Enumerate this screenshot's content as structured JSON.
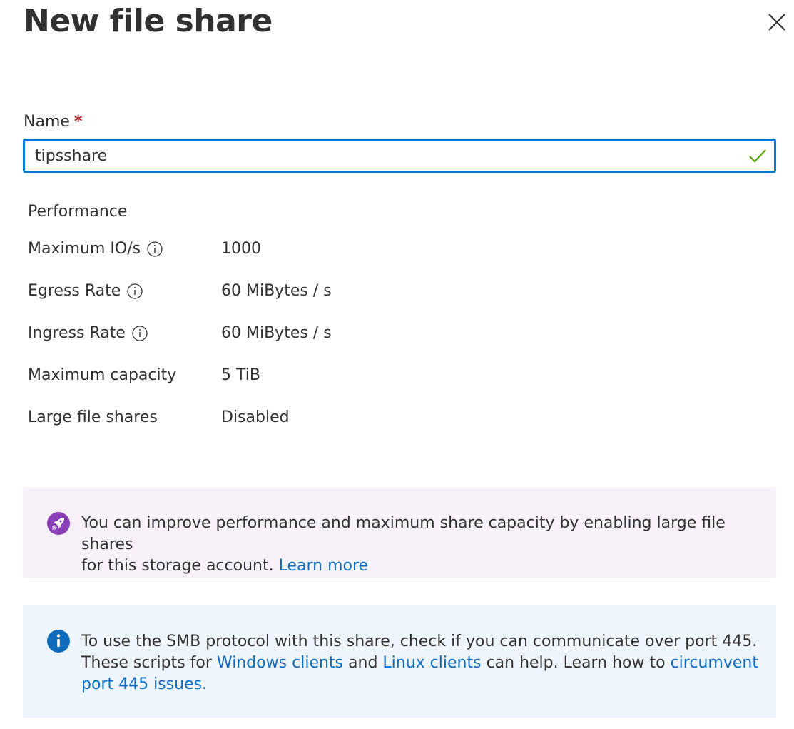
{
  "panel": {
    "title": "New file share",
    "close_icon": "close-icon"
  },
  "name_field": {
    "label": "Name",
    "required_marker": "*",
    "value": "tipsshare",
    "status_icon": "checkmark-icon",
    "status_color": "#57a300",
    "border_color": "#0078d4"
  },
  "performance": {
    "heading": "Performance",
    "rows": [
      {
        "label": "Maximum IO/s",
        "value": "1000",
        "info_icon": true
      },
      {
        "label": "Egress Rate",
        "value": "60 MiBytes / s",
        "info_icon": true
      },
      {
        "label": "Ingress Rate",
        "value": "60 MiBytes / s",
        "info_icon": true
      },
      {
        "label": "Maximum capacity",
        "value": "5 TiB",
        "info_icon": false
      },
      {
        "label": "Large file shares",
        "value": "Disabled",
        "info_icon": false
      }
    ]
  },
  "large_file_banner": {
    "icon": "rocket-icon",
    "icon_color": "#8a3eb8",
    "background": "#f7f2f9",
    "line1": "You can improve performance and maximum share capacity by enabling large file shares",
    "line2_text": "for this storage account.",
    "link": "Learn more"
  },
  "smb_banner": {
    "icon": "info-icon",
    "icon_color": "#0f6cbd",
    "background": "#eff5fd",
    "line1": "To use the SMB protocol with this share, check if you can communicate over port 445.",
    "line2_prefix": "These scripts for",
    "link_windows": "Windows clients",
    "and_text": "and",
    "link_linux": "Linux clients",
    "line2_suffix": "can help. Learn how to",
    "link_circumvent_1": "circumvent",
    "link_circumvent_2": "port 445 issues."
  },
  "colors": {
    "text": "#323130",
    "link": "#0f6cbd",
    "required": "#a4262c"
  }
}
